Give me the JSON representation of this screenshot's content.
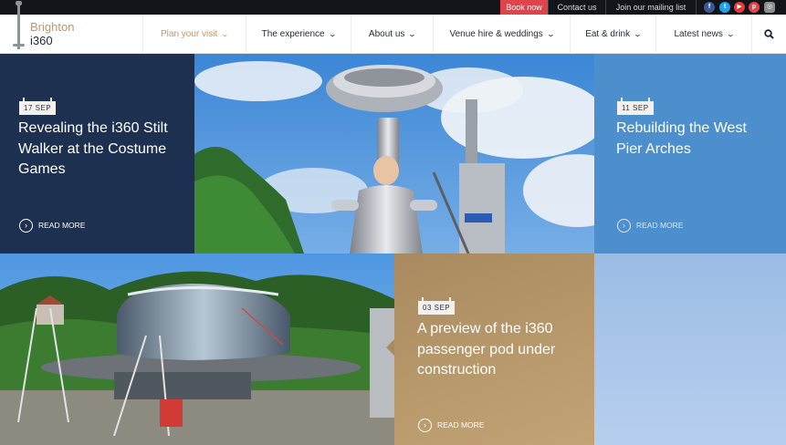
{
  "topbar": {
    "book_now": "Book now",
    "contact_us": "Contact us",
    "mailing_list": "Join our mailing list",
    "social": [
      "facebook-icon",
      "twitter-icon",
      "youtube-icon",
      "pinterest-icon",
      "instagram-icon"
    ]
  },
  "logo": {
    "line1": "Brighton",
    "line2": "i360"
  },
  "nav": {
    "items": [
      {
        "label": "Plan your visit",
        "active": true
      },
      {
        "label": "The experience"
      },
      {
        "label": "About us"
      },
      {
        "label": "Venue hire & weddings"
      },
      {
        "label": "Eat & drink"
      },
      {
        "label": "Latest news"
      }
    ],
    "search_icon": "search-icon"
  },
  "tiles": {
    "stilt": {
      "date": "17 SEP",
      "title": "Revealing the i360 Stilt Walker at the Costume Games",
      "read_more": "READ MORE",
      "color": "#1e3050"
    },
    "arches": {
      "date": "11 SEP",
      "title": "Rebuilding the West Pier Arches",
      "read_more": "READ MORE",
      "color": "#4c8fcc"
    },
    "pod": {
      "date": "03 SEP",
      "title": "A preview of the i360 passenger pod under construction",
      "read_more": "READ MORE",
      "color": "#b09168"
    }
  },
  "colors": {
    "accent": "#c7956a",
    "book_red": "#e0444b",
    "navy": "#1f2a3a"
  }
}
